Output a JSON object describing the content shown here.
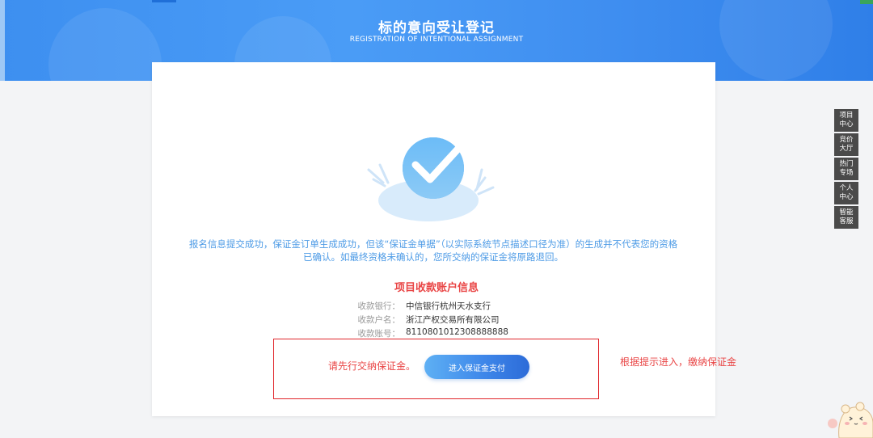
{
  "banner": {
    "title": "标的意向受让登记",
    "subtitle": "REGISTRATION OF INTENTIONAL ASSIGNMENT"
  },
  "result": {
    "message": "报名信息提交成功，保证金订单生成成功，但该“保证金单据”（以实际系统节点描述口径为准）的生成并不代表您的资格已确认。如最终资格未确认的，您所交纳的保证金将原路退回。"
  },
  "account": {
    "title": "项目收款账户信息",
    "rows": [
      {
        "label": "收款银行：",
        "value": "中信银行杭州天水支行"
      },
      {
        "label": "收款户名：",
        "value": "浙江产权交易所有限公司"
      },
      {
        "label": "收款账号：",
        "value": "8110801012308888888"
      }
    ]
  },
  "payment": {
    "prompt": "请先行交纳保证金。",
    "button_label": "进入保证金支付"
  },
  "annotation": {
    "hint": "根据提示进入，缴纳保证金"
  },
  "side_nav": [
    {
      "line1": "项目",
      "line2": "中心"
    },
    {
      "line1": "竞价",
      "line2": "大厅"
    },
    {
      "line1": "热门",
      "line2": "专场"
    },
    {
      "line1": "个人",
      "line2": "中心"
    },
    {
      "line1": "智能",
      "line2": "客服"
    }
  ],
  "colors": {
    "banner_blue": "#3d8ff0",
    "accent_red": "#e94545",
    "message_blue": "#4d9be6",
    "side_nav_bg": "#4a4a4a"
  }
}
